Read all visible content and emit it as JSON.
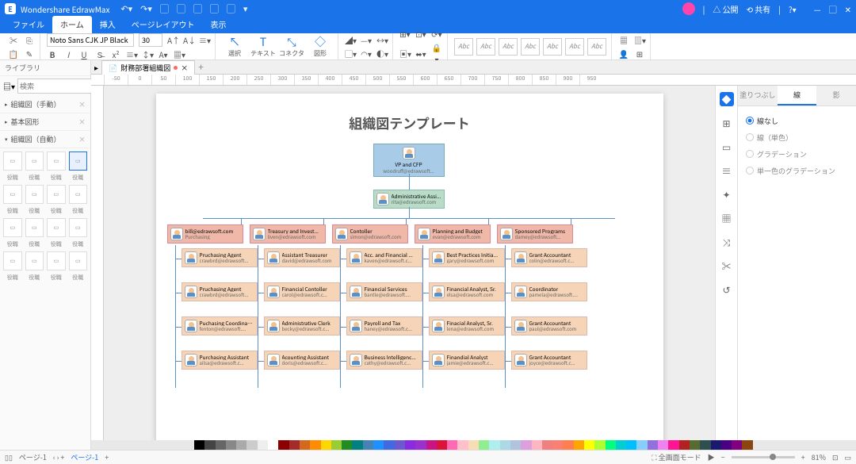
{
  "app": {
    "name": "Wondershare EdrawMax"
  },
  "titlebar_right": {
    "publish": "公開",
    "share": "共有"
  },
  "menus": [
    "ファイル",
    "ホーム",
    "挿入",
    "ページレイアウト",
    "表示"
  ],
  "active_menu": 1,
  "ribbon": {
    "font": "Noto Sans CJK JP Black",
    "size": "30",
    "tools": [
      {
        "label": "選択"
      },
      {
        "label": "テキスト"
      },
      {
        "label": "コネクタ"
      },
      {
        "label": "図形"
      }
    ]
  },
  "styleboxes": [
    "Abc",
    "Abc",
    "Abc",
    "Abc",
    "Abc",
    "Abc",
    "Abc"
  ],
  "leftpanel": {
    "title": "ライブラリ",
    "search_placeholder": "検索",
    "cats": [
      "組織図（手動）",
      "基本図形",
      "組織図（自動）"
    ],
    "shape_label": "役職"
  },
  "doctab": {
    "name": "財務部署組織図"
  },
  "ruler_marks": [
    "-50",
    "0",
    "50",
    "100",
    "150",
    "200",
    "250",
    "300",
    "350",
    "400",
    "450",
    "500",
    "550",
    "600",
    "650",
    "700",
    "750",
    "800",
    "850",
    "900",
    "950"
  ],
  "page": {
    "title": "組織図テンプレート",
    "top": {
      "t1": "VP and CFP",
      "t2": "woodruff@edrawsoft..."
    },
    "assist": {
      "t1": "Administrative Assi...",
      "t2": "rita@edrawsoft.com"
    },
    "depts": [
      {
        "t1": "bill@edrawsoft.com",
        "t2": "Purchasing"
      },
      {
        "t1": "Treasury and Invest...",
        "t2": "liven@edrawsoft.com"
      },
      {
        "t1": "Contoller",
        "t2": "simon@edrawsoft.com"
      },
      {
        "t1": "Planning and Budget",
        "t2": "evan@edrawsoft.com"
      },
      {
        "t1": "Sponsored Programs",
        "t2": "damey@edrawsoft..."
      }
    ],
    "rows": [
      [
        {
          "t1": "Pruchasing Agent",
          "t2": "crawbrd@edrawsoft..."
        },
        {
          "t1": "Assistant Treasurer",
          "t2": "david@edrawsoft.com"
        },
        {
          "t1": "Acc. and Financial ...",
          "t2": "kaven@edrawsoft.c..."
        },
        {
          "t1": "Best Practices Initia...",
          "t2": "gary@edrawsoft.com"
        },
        {
          "t1": "Grant Accountant",
          "t2": "colin@edrawsoft.c..."
        }
      ],
      [
        {
          "t1": "Pruchasing Agent",
          "t2": "crawbrd@edrawsoft..."
        },
        {
          "t1": "Financial Contoller",
          "t2": "carol@edrawsoft.c..."
        },
        {
          "t1": "Financial Services",
          "t2": "bantle@edrawsoft...."
        },
        {
          "t1": "Financial Analyst, Sr.",
          "t2": "elsa@edrawsoft.com"
        },
        {
          "t1": "Coordinator",
          "t2": "pamela@edrawsoft...."
        }
      ],
      [
        {
          "t1": "Puchasing Coordinator",
          "t2": "fenton@edrawsoft...."
        },
        {
          "t1": "Administrative Clerk",
          "t2": "becky@edrawsoft.c..."
        },
        {
          "t1": "Payroll and Tax",
          "t2": "haney@edrawsoft.c..."
        },
        {
          "t1": "Finacial Analyst, Sr.",
          "t2": "lena@edrawsoft.com"
        },
        {
          "t1": "Grant Accountant",
          "t2": "paul@edrawsoft.com"
        }
      ],
      [
        {
          "t1": "Purchasing Assistant",
          "t2": "ailsa@edrawsoft.c..."
        },
        {
          "t1": "Acounting Assistant",
          "t2": "doris@edrawsoft.c..."
        },
        {
          "t1": "Business Intelligenc...",
          "t2": "cathy@edrawsoft.c..."
        },
        {
          "t1": "Finandial Analyst",
          "t2": "jamie@edrawsoft.c..."
        },
        {
          "t1": "Grant Accountant",
          "t2": "joyce@edrawsoft.c..."
        }
      ]
    ]
  },
  "rightpanel": {
    "tabs": [
      "塗りつぶし",
      "線",
      "影"
    ],
    "active": 1,
    "opts": [
      "線なし",
      "線（単色）",
      "グラデーション",
      "単一色のグラデーション"
    ],
    "selected": 0
  },
  "colorbar": [
    "#000",
    "#444",
    "#666",
    "#888",
    "#aaa",
    "#ccc",
    "#eee",
    "#fff",
    "#8b0000",
    "#a52a2a",
    "#d2691e",
    "#ff8c00",
    "#ffd700",
    "#9acd32",
    "#228b22",
    "#008080",
    "#4682b4",
    "#1e90ff",
    "#4169e1",
    "#6a5acd",
    "#8a2be2",
    "#9932cc",
    "#c71585",
    "#dc143c",
    "#ff69b4",
    "#ffc0cb",
    "#f5deb3",
    "#90ee90",
    "#afeeee",
    "#add8e6",
    "#b0c4de",
    "#dda0dd",
    "#ffb6c1",
    "#f08080",
    "#fa8072",
    "#ff7f50",
    "#ffa500",
    "#ffff00",
    "#adff2f",
    "#00ff7f",
    "#00ced1",
    "#00bfff",
    "#87cefa",
    "#9370db",
    "#ee82ee",
    "#ff1493",
    "#b22222",
    "#556b2f",
    "#2f4f4f",
    "#191970",
    "#4b0082",
    "#800080",
    "#8b4513"
  ],
  "status": {
    "page_label": "ページ-1",
    "page_tab": "ページ-1",
    "fullscreen": "全画面モード",
    "zoom": "81%"
  }
}
